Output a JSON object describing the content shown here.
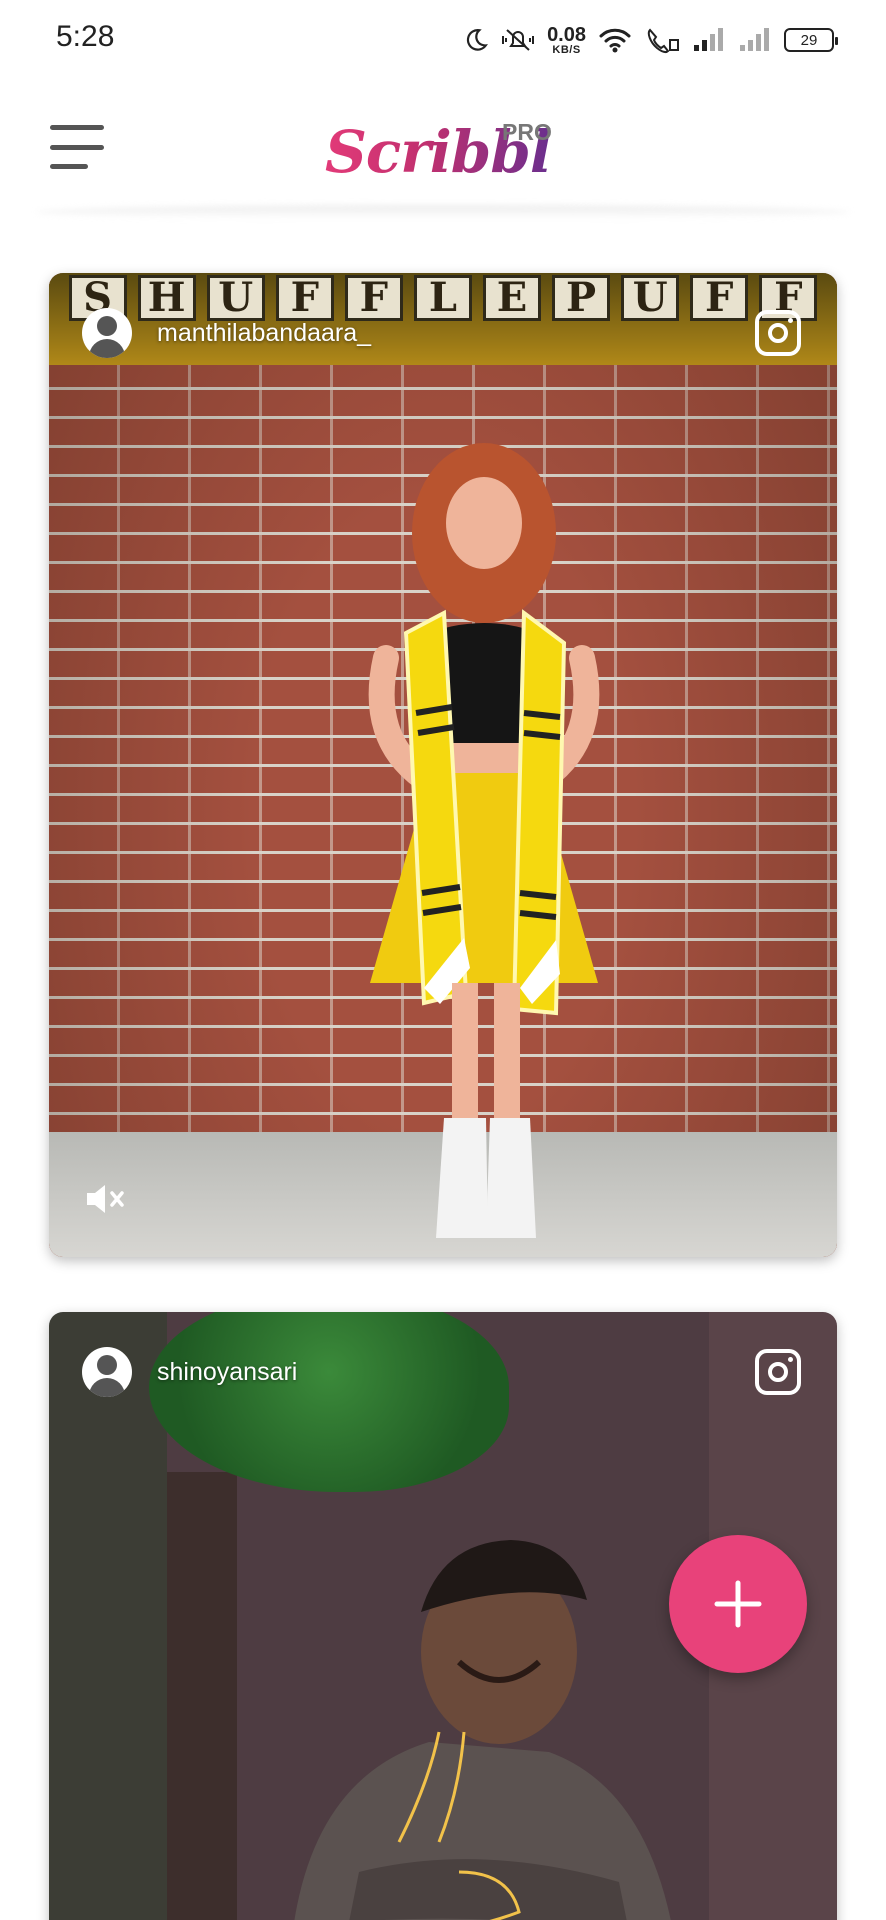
{
  "status_bar": {
    "time": "5:28",
    "net_speed_value": "0.08",
    "net_speed_unit": "KB/S",
    "battery": "29",
    "icons": [
      "moon-icon",
      "vibrate-icon",
      "wifi-icon",
      "wifi-calling-icon",
      "signal-icon",
      "signal-icon"
    ]
  },
  "header": {
    "logo_text": "Scribbl",
    "logo_badge": "PRO",
    "accent_color": "#e23a78"
  },
  "posts": [
    {
      "username": "manthilabandaara_",
      "sign_letters": [
        "S",
        "H",
        "U",
        "F",
        "F",
        "L",
        "E",
        "P",
        "U",
        "F",
        "F"
      ],
      "muted": true
    },
    {
      "username": "shinoyansari"
    }
  ],
  "fab": {
    "icon": "plus-icon",
    "color": "#e8427a"
  }
}
